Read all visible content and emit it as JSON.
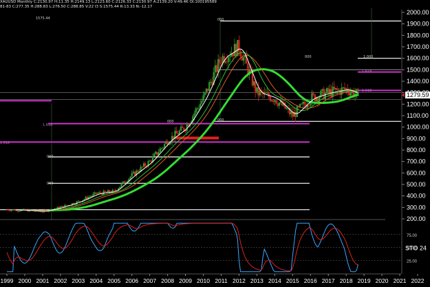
{
  "header": {
    "line1": "XAUUSD Monthly  C:2130.97  H:11.35  H:2149.13  L:2123.60  C:2126.33  C:2130.97  A:2139.20  V:49.4K  OI:100195589",
    "line2": "81-83  C:277.35  H:288.83  L:276.50  C:288.85  V:22  I3  S:1575.44  R:13.33  N:-12.17"
  },
  "top_left_value": "1575.44",
  "price_axis": {
    "labels": [
      "2000.00",
      "1900.00",
      "1800.00",
      "1700.00",
      "1600.00",
      "1500.00",
      "1400.00",
      "1300.00",
      "1200.00",
      "1100.00",
      "1000.00",
      "900.00",
      "800.00",
      "700.00",
      "600.00",
      "500.00",
      "400.00",
      "300.00",
      "200.00"
    ],
    "current_price": "1279.59"
  },
  "indicator": {
    "name": "STO 24",
    "levels": [
      "75.00",
      "50.00",
      "25.00"
    ]
  },
  "x_axis": {
    "years": [
      "1999",
      "2000",
      "2001",
      "2002",
      "2003",
      "2004",
      "2005",
      "2006",
      "2007",
      "2008",
      "2009",
      "2010",
      "2011",
      "2012",
      "2013",
      "2014",
      "2015",
      "2016",
      "2017",
      "2018",
      "2019",
      "2020",
      "2021",
      "2022"
    ]
  },
  "annotations": {
    "fib_labels": [
      "1.618",
      "1.618",
      "1.618",
      "1.618"
    ],
    "level_tags": [
      "000",
      "000",
      "000",
      "000",
      "000",
      "1.000",
      "000"
    ]
  },
  "colors": {
    "background": "#000000",
    "up_candle": "#2e9e2e",
    "down_candle": "#e02020",
    "ma_fast": "#ffffff",
    "ma_mid": "#2fbf2f",
    "ma_slow": "#e05a2a",
    "ma_long": "#33dd33",
    "fib_line": "#cc33cc",
    "stoch_k": "#3aa6ff",
    "stoch_d": "#e02020"
  },
  "chart_data": {
    "type": "line",
    "title": "",
    "x": [
      1999,
      2000,
      2001,
      2002,
      2003,
      2004,
      2005,
      2006,
      2007,
      2008,
      2009,
      2010,
      2011,
      2012,
      2013,
      2014,
      2015,
      2016,
      2017,
      2018,
      2018.7
    ],
    "series": [
      {
        "values": [
          280,
          275,
          265,
          300,
          350,
          420,
          440,
          580,
          700,
          880,
          1000,
          1250,
          1600,
          1700,
          1300,
          1250,
          1100,
          1250,
          1300,
          1330,
          1280
        ]
      }
    ],
    "ylim": [
      200,
      2000
    ],
    "ylabel": "",
    "xlabel": ""
  }
}
